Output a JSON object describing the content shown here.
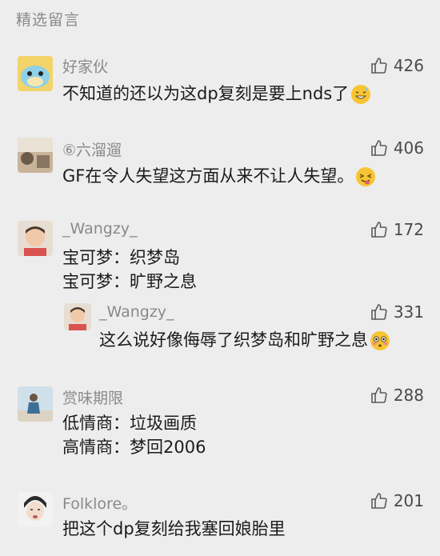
{
  "section_title": "精选留言",
  "comments": [
    {
      "nickname": "好家伙",
      "likes": "426",
      "lines": [
        "不知道的还以为这dp复刻是要上nds了"
      ],
      "emoji": "sweat-smile-icon"
    },
    {
      "nickname": "⑥六溜遛",
      "likes": "406",
      "lines": [
        "GF在令人失望这方面从来不让人失望。"
      ],
      "emoji": "tongue-wink-icon"
    },
    {
      "nickname": "_Wangzy_",
      "likes": "172",
      "lines": [
        "宝可梦：织梦岛",
        "宝可梦：旷野之息"
      ]
    },
    {
      "nickname": "_Wangzy_",
      "likes": "331",
      "lines": [
        "这么说好像侮辱了织梦岛和旷野之息"
      ],
      "emoji": "flushed-icon",
      "reply": true
    },
    {
      "nickname": "赏味期限",
      "likes": "288",
      "lines": [
        "低情商：垃圾画质",
        "高情商：梦回2006"
      ]
    },
    {
      "nickname": "Folklore。",
      "likes": "201",
      "lines": [
        "把这个dp复刻给我塞回娘胎里"
      ]
    }
  ]
}
